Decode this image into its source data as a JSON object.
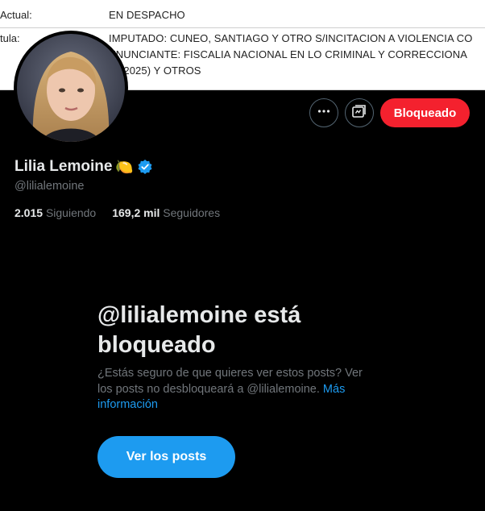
{
  "document": {
    "row1_label": "Actual:",
    "row1_value": "EN DESPACHO",
    "row2_label": "tula:",
    "row2_line1": "IMPUTADO: CUNEO, SANTIAGO Y OTRO S/INCITACION A VIOLENCIA CO",
    "row2_line2": "ENUNCIANTE: FISCALIA NACIONAL EN LO CRIMINAL Y CORRECCIONA",
    "row2_line3": "30/2025) Y OTROS"
  },
  "profile": {
    "name": "Lilia Lemoine",
    "emoji": "🍋",
    "handle": "@lilialemoine",
    "following_count": "2.015",
    "following_label": "Siguiendo",
    "followers_count": "169,2 mil",
    "followers_label": "Seguidores"
  },
  "header_buttons": {
    "more_icon": "more-dots-icon",
    "notify_icon": "notifications-icon",
    "blocked_label": "Bloqueado"
  },
  "blocked_notice": {
    "title": "@lilialemoine está bloqueado",
    "description": "¿Estás seguro de que quieres ver estos posts? Ver los posts no desbloqueará a @lilialemoine.",
    "link_text": "Más información",
    "view_posts_label": "Ver los posts"
  },
  "colors": {
    "background": "#000000",
    "accent": "#1d9bf0",
    "danger": "#f4212e",
    "muted_text": "#71767b",
    "primary_text": "#e7e9ea"
  }
}
